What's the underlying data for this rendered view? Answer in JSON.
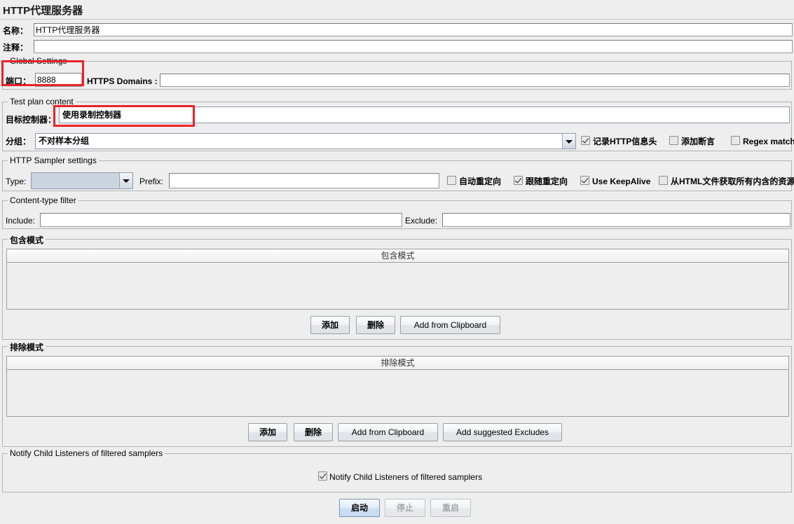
{
  "window": {
    "title": "HTTP代理服务器"
  },
  "form": {
    "name_label": "名称：",
    "name_value": "HTTP代理服务器",
    "comment_label": "注释：",
    "comment_value": ""
  },
  "global_settings": {
    "legend": "Global Settings",
    "port_label": "端口：",
    "port_value": "8888",
    "https_domains_label": "HTTPS Domains :",
    "https_domains_value": ""
  },
  "test_plan_content": {
    "legend": "Test plan content",
    "target_controller_label": "目标控制器：",
    "target_controller_value": "使用录制控制器",
    "grouping_label": "分组：",
    "grouping_value": "不对样本分组",
    "checkboxes": [
      {
        "label": "记录HTTP信息头",
        "checked": true
      },
      {
        "label": "添加断言",
        "checked": false
      },
      {
        "label": "Regex matching",
        "checked": false
      }
    ]
  },
  "http_sampler_settings": {
    "legend": "HTTP Sampler settings",
    "type_label": "Type:",
    "type_value": "",
    "prefix_label": "Prefix:",
    "prefix_value": "",
    "checkboxes": [
      {
        "label": "自动重定向",
        "checked": false
      },
      {
        "label": "跟随重定向",
        "checked": true
      },
      {
        "label": "Use KeepAlive",
        "checked": true
      },
      {
        "label": "从HTML文件获取所有内含的资源",
        "checked": false
      }
    ]
  },
  "content_type_filter": {
    "legend": "Content-type filter",
    "include_label": "Include:",
    "include_value": "",
    "exclude_label": "Exclude:",
    "exclude_value": ""
  },
  "include_patterns": {
    "legend": "包含模式",
    "column_header": "包含模式",
    "rows": [],
    "buttons": [
      {
        "label": "添加",
        "lang": "cn"
      },
      {
        "label": "删除",
        "lang": "cn"
      },
      {
        "label": "Add from Clipboard",
        "lang": "en"
      }
    ]
  },
  "exclude_patterns": {
    "legend": "排除模式",
    "column_header": "排除模式",
    "rows": [],
    "buttons": [
      {
        "label": "添加",
        "lang": "cn"
      },
      {
        "label": "删除",
        "lang": "cn"
      },
      {
        "label": "Add from Clipboard",
        "lang": "en"
      },
      {
        "label": "Add suggested Excludes",
        "lang": "en"
      }
    ]
  },
  "notify_child_listeners": {
    "legend": "Notify Child Listeners of filtered samplers",
    "checkbox_label": "Notify Child Listeners of filtered samplers",
    "checked": true
  },
  "actions": [
    {
      "label": "启动",
      "state": "focused"
    },
    {
      "label": "停止",
      "state": "disabled"
    },
    {
      "label": "重启",
      "state": "disabled"
    }
  ],
  "annotations": {
    "highlight_color": "#ec2227",
    "boxes": [
      "port-field-highlight",
      "target-controller-highlight"
    ]
  }
}
